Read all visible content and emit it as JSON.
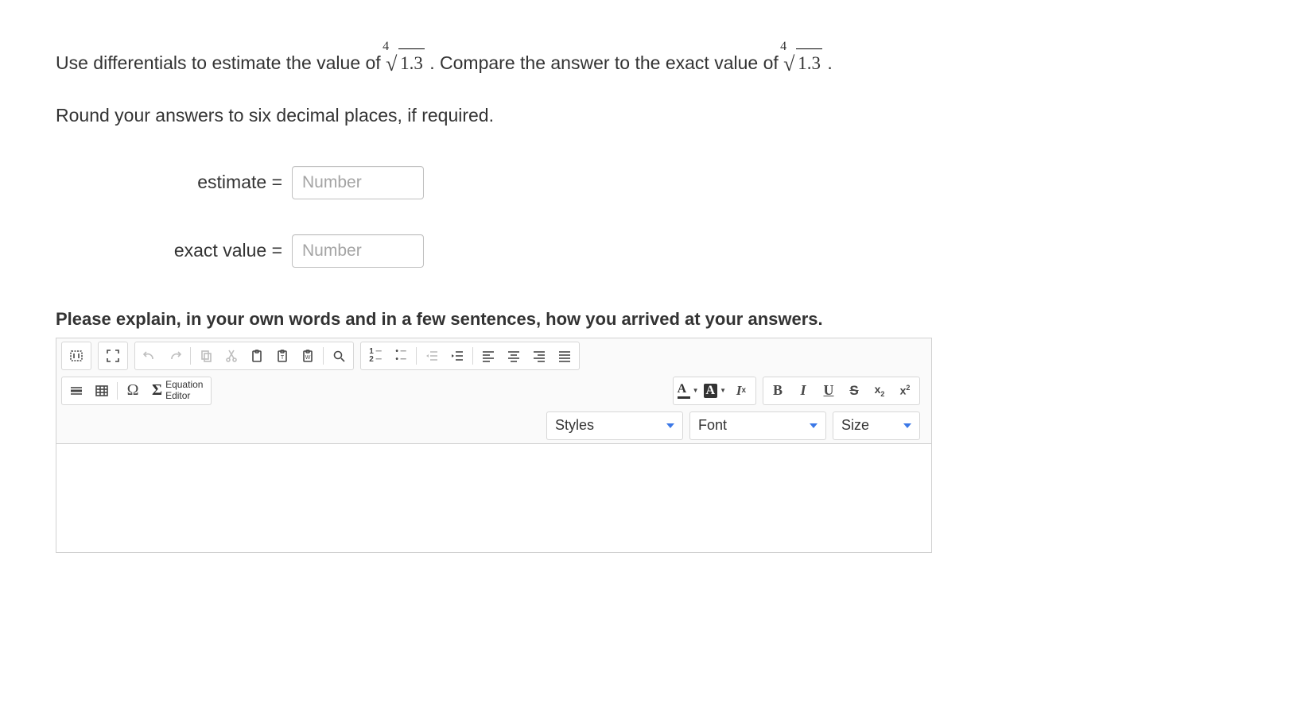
{
  "question": {
    "part1": "Use differentials to estimate the value of ",
    "root": {
      "index": "4",
      "radicand": "1.3"
    },
    "part2": ". Compare the answer to the exact value of ",
    "root2": {
      "index": "4",
      "radicand": "1.3"
    },
    "part3": "."
  },
  "instruction": "Round your answers to six decimal places, if required.",
  "answers": {
    "estimate": {
      "label": "estimate =",
      "placeholder": "Number",
      "value": ""
    },
    "exact": {
      "label": "exact value =",
      "placeholder": "Number",
      "value": ""
    }
  },
  "explain_prompt": "Please explain, in your own words and in a few sentences, how you arrived at your answers.",
  "editor": {
    "equation_button": {
      "label_top": "Equation",
      "label_bottom": "Editor"
    },
    "text_color_letter": "A",
    "text_color_underline": "#333333",
    "highlight_letter": "A",
    "highlight_box_bg": "#333333",
    "highlight_letter_color": "#ffffff",
    "remove_format": "Iₓ",
    "bold": "B",
    "italic": "I",
    "underline": "U",
    "strike": "S",
    "sub": "x",
    "sub_idx": "2",
    "sup": "x",
    "sup_idx": "2",
    "dropdowns": {
      "styles": "Styles",
      "font": "Font",
      "size": "Size"
    }
  }
}
